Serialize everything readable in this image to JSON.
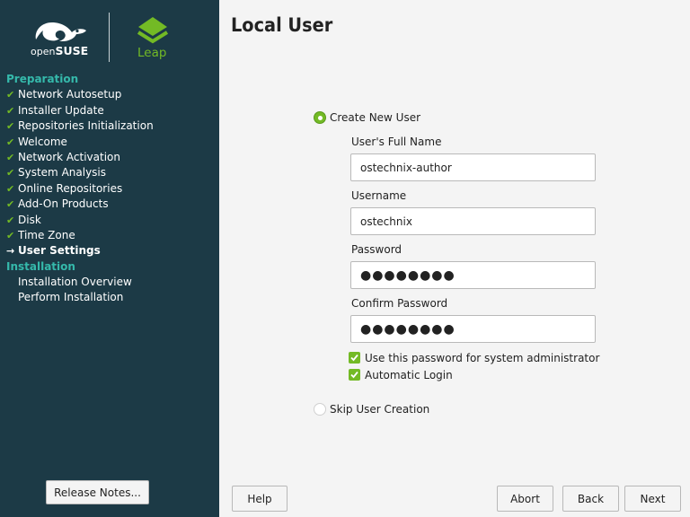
{
  "brand": {
    "os_pre": "open",
    "os_name": "SUSE",
    "edition": "Leap"
  },
  "sidebar": {
    "sections": [
      {
        "title": "Preparation",
        "steps": [
          {
            "label": "Network Autosetup",
            "state": "done"
          },
          {
            "label": "Installer Update",
            "state": "done"
          },
          {
            "label": "Repositories Initialization",
            "state": "done"
          },
          {
            "label": "Welcome",
            "state": "done"
          },
          {
            "label": "Network Activation",
            "state": "done"
          },
          {
            "label": "System Analysis",
            "state": "done"
          },
          {
            "label": "Online Repositories",
            "state": "done"
          },
          {
            "label": "Add-On Products",
            "state": "done"
          },
          {
            "label": "Disk",
            "state": "done"
          },
          {
            "label": "Time Zone",
            "state": "done"
          },
          {
            "label": "User Settings",
            "state": "current"
          }
        ]
      },
      {
        "title": "Installation",
        "steps": [
          {
            "label": "Installation Overview",
            "state": "pending"
          },
          {
            "label": "Perform Installation",
            "state": "pending"
          }
        ]
      }
    ],
    "release_notes_label": "Release Notes..."
  },
  "main": {
    "title": "Local User",
    "create_user_label": "Create New User",
    "full_name": {
      "label": "User's Full Name",
      "value": "ostechnix-author"
    },
    "username": {
      "label": "Username",
      "value": "ostechnix"
    },
    "password": {
      "label": "Password",
      "value": "●●●●●●●●"
    },
    "confirm_password": {
      "label": "Confirm Password",
      "value": "●●●●●●●●"
    },
    "use_for_admin_label": "Use this password for system administrator",
    "auto_login_label": "Automatic Login",
    "skip_label": "Skip User Creation"
  },
  "buttons": {
    "help": "Help",
    "abort": "Abort",
    "back": "Back",
    "next": "Next"
  },
  "colors": {
    "sidebar_bg": "#1c3a46",
    "accent_green": "#73ba25",
    "section_teal": "#35b9ab"
  }
}
